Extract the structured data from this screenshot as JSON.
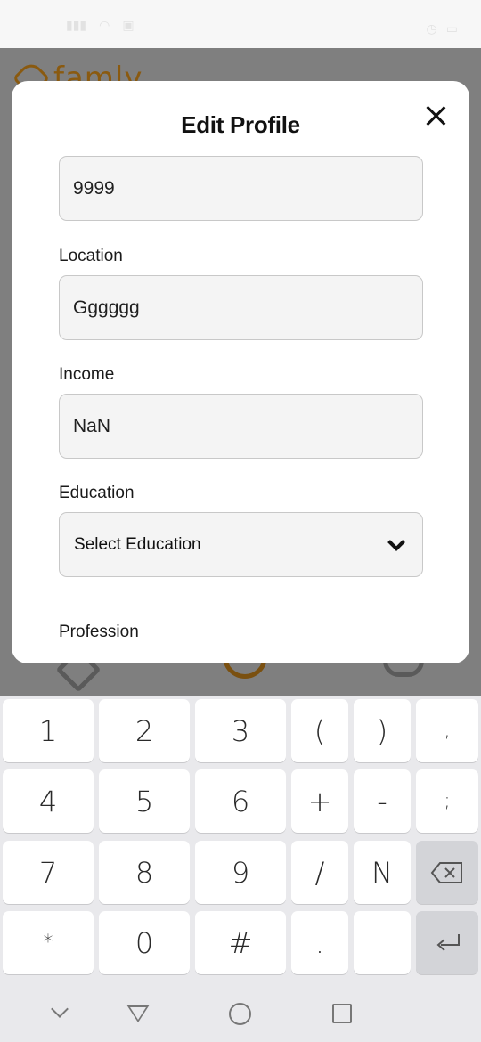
{
  "app": {
    "logo_text": "famly"
  },
  "modal": {
    "title": "Edit Profile",
    "fields": [
      {
        "label": "",
        "value": "9999"
      },
      {
        "label": "Location",
        "value": "Gggggg"
      },
      {
        "label": "Income",
        "value": "NaN"
      },
      {
        "label": "Education",
        "value": "Select Education"
      },
      {
        "label": "Profession",
        "value": ""
      }
    ]
  },
  "keyboard": {
    "row1": [
      "1",
      "2",
      "3",
      "(",
      ")",
      ","
    ],
    "row2": [
      "4",
      "5",
      "6",
      "+",
      "-",
      ";"
    ],
    "row3": [
      "7",
      "8",
      "9",
      "/",
      "N"
    ],
    "row4": [
      "*",
      "0",
      "#",
      ".",
      ""
    ]
  },
  "colors": {
    "modal_bg": "#ffffff",
    "input_bg": "#f4f4f4",
    "overlay": "#7f7f7f",
    "brand": "#8a5a10"
  }
}
